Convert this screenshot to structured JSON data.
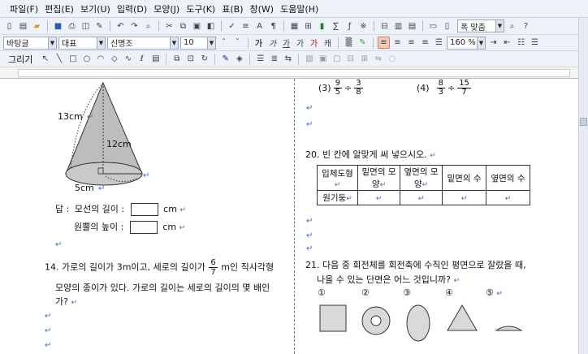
{
  "menu": [
    "파일(F)",
    "편집(E)",
    "보기(U)",
    "입력(D)",
    "모양(J)",
    "도구(K)",
    "표(B)",
    "창(W)",
    "도움말(H)"
  ],
  "toolbar": {
    "style_combo": "바탕글",
    "font_type_combo": "대표",
    "font_combo": "신명조",
    "size_combo": "10",
    "zoom_combo": "160 %",
    "fit_combo": "폭 맞춤",
    "draw_label": "그리기"
  },
  "left": {
    "cone": {
      "slant_label": "13cm",
      "height_label": "12cm",
      "radius_label": "5cm"
    },
    "answer": {
      "prefix": "답 :",
      "slant_question": "모선의 길이 :",
      "height_question": "원뿔의 높이 :",
      "unit": "cm"
    },
    "q14": {
      "line1_a": "14. 가로의 길이가 3m이고, 세로의 길이가",
      "frac_num": "6",
      "frac_den": "7",
      "line1_b": "m인 직사각형",
      "line2": "모양의 종이가 있다. 가로의 길이는 세로의 길이의 몇 배인",
      "line3": "가?"
    }
  },
  "right": {
    "q3": {
      "num": "(3)",
      "f1_num": "9",
      "f1_den": "5",
      "op": "÷",
      "f2_num": "3",
      "f2_den": "8"
    },
    "q4": {
      "num": "(4)",
      "f1_num": "8",
      "f1_den": "3",
      "op": "÷",
      "f2_num": "15",
      "f2_den": "7"
    },
    "q20": {
      "title": "20. 빈 칸에 알맞게 써 넣으시오.",
      "headers": [
        "입체도형",
        "밑면의 모양",
        "옆면의 모양",
        "밑면의 수",
        "옆면의 수"
      ],
      "row_label": "원기둥"
    },
    "q21": {
      "line1": "21. 다음 중 회전체를 회전축에 수직인 평면으로 잘랐을 때,",
      "line2": "나올 수 있는 단면은 어느 것입니까?",
      "options": [
        "①",
        "②",
        "③",
        "④",
        "⑤"
      ]
    }
  }
}
